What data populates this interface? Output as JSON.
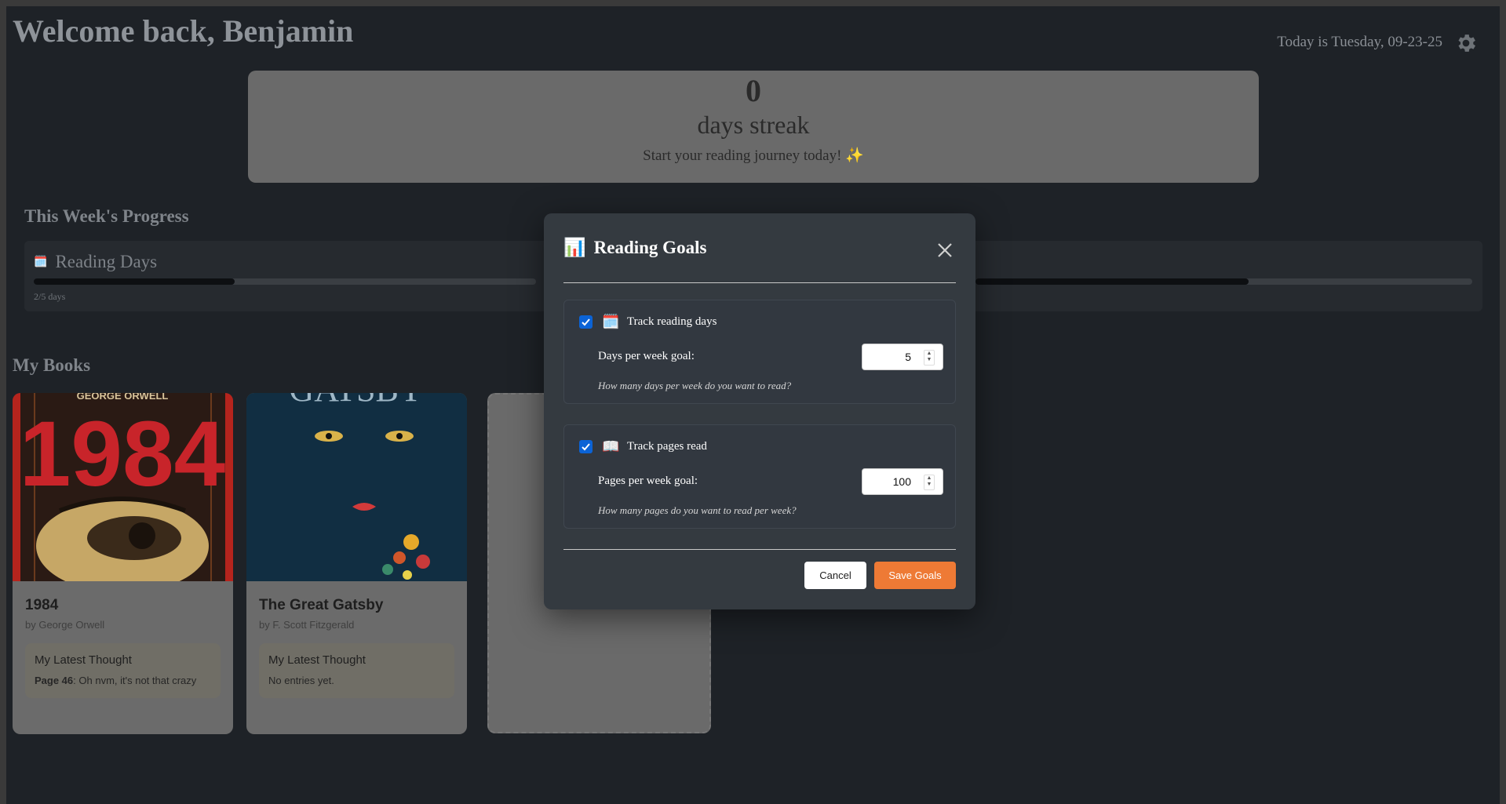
{
  "header": {
    "welcome": "Welcome back, Benjamin",
    "date_text": "Today is Tuesday, 09-23-25",
    "settings_icon": "gear-icon"
  },
  "streak": {
    "count": "0",
    "label": "days streak",
    "message": "Start your reading journey today! ✨"
  },
  "weekly": {
    "title": "This Week's Progress",
    "reading_days_label": "Reading Days",
    "reading_days_note": "2/5 days",
    "reading_days_progress": 0.4,
    "pages_progress": 0.55
  },
  "books": {
    "title": "My Books",
    "items": [
      {
        "cover_title": "1984",
        "cover_author": "GEORGE ORWELL",
        "title": "1984",
        "author": "by George Orwell",
        "thought_heading": "My Latest Thought",
        "thought_page": "Page 46",
        "thought_text": ": Oh nvm, it's not that crazy"
      },
      {
        "cover_title": "GATSBY",
        "title": "The Great Gatsby",
        "author": "by F. Scott Fitzgerald",
        "thought_heading": "My Latest Thought",
        "thought_text": "No entries yet."
      }
    ]
  },
  "modal": {
    "title": "Reading Goals",
    "title_icon": "📊",
    "goals": [
      {
        "checked": true,
        "icon": "🗓️",
        "label": "Track reading days",
        "field_label": "Days per week goal:",
        "value": "5",
        "help": "How many days per week do you want to read?"
      },
      {
        "checked": true,
        "icon": "📖",
        "label": "Track pages read",
        "field_label": "Pages per week goal:",
        "value": "100",
        "help": "How many pages do you want to read per week?"
      }
    ],
    "cancel_label": "Cancel",
    "save_label": "Save Goals"
  },
  "colors": {
    "accent": "#ee7a35",
    "checkbox": "#0b63d6",
    "modal_bg": "#343a40",
    "page_bg": "#1e2227"
  }
}
